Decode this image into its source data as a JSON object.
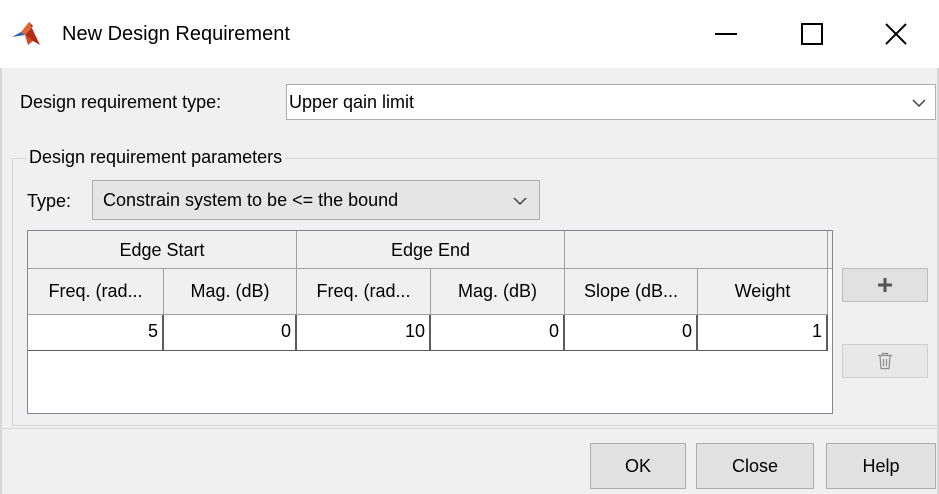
{
  "window": {
    "title": "New Design Requirement",
    "icon": "matlab-logo-icon",
    "controls": [
      "minimize-icon",
      "maximize-icon",
      "close-icon"
    ]
  },
  "requirement_type": {
    "label": "Design requirement type:",
    "value": "Upper qain limit"
  },
  "parameters": {
    "legend": "Design requirement parameters",
    "type_label": "Type:",
    "type_value": "Constrain system to be <= the bound"
  },
  "table": {
    "group_headers": [
      "Edge Start",
      "Edge End",
      ""
    ],
    "columns": [
      "Freq. (rad...",
      "Mag. (dB)",
      "Freq. (rad...",
      "Mag. (dB)",
      "Slope (dB...",
      "Weight"
    ],
    "rows": [
      [
        "5",
        "0",
        "10",
        "0",
        "0",
        "1"
      ]
    ]
  },
  "side_buttons": {
    "add": "plus-icon",
    "delete": "trash-icon"
  },
  "footer": {
    "ok": "OK",
    "close": "Close",
    "help": "Help"
  },
  "colors": {
    "matlab_orange": "#e16737",
    "matlab_red": "#b62b14",
    "matlab_blue": "#2f5fb2"
  }
}
